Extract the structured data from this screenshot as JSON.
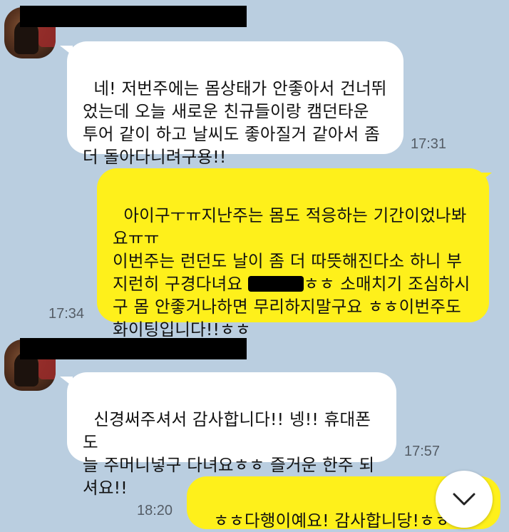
{
  "messages": [
    {
      "sender": "them",
      "text": "네! 저번주에는 몸상태가 안좋아서 건너뛰\n었는데 오늘 새로운 친규들이랑 캠던타운\n투어 같이 하고 날씨도 좋아질거 같아서 좀\n더 돌아다니려구용!!",
      "time": "17:31"
    },
    {
      "sender": "me",
      "text_before": "아이구ㅜㅠ지난주는 몸도 적응하는 기간이었나봐\n요ㅠㅠ\n이번주는 런던도 날이 좀 더 따뜻해진다소 하니 부\n지런히 구경다녀요 ",
      "text_after": "ㅎㅎ 소매치기 조심하시\n구 몸 안좋거나하면 무리하지말구요 ㅎㅎ이번주도\n화이팅입니다!!ㅎㅎ",
      "time": "17:34"
    },
    {
      "sender": "them",
      "text": "신경써주셔서 감사합니다!! 넹!! 휴대폰도\n늘 주머니넣구 다녀요ㅎㅎ 즐거운 한주 되\n셔요!!",
      "time": "17:57"
    },
    {
      "sender": "me",
      "text": "ㅎㅎ다행이예요! 감사합니당!ㅎㅎ",
      "time": "18:20"
    }
  ],
  "colors": {
    "background": "#bacee0",
    "incoming_bubble": "#ffffff",
    "outgoing_bubble": "#fef01b"
  },
  "icons": {
    "scroll_down": "chevron-down-icon"
  }
}
